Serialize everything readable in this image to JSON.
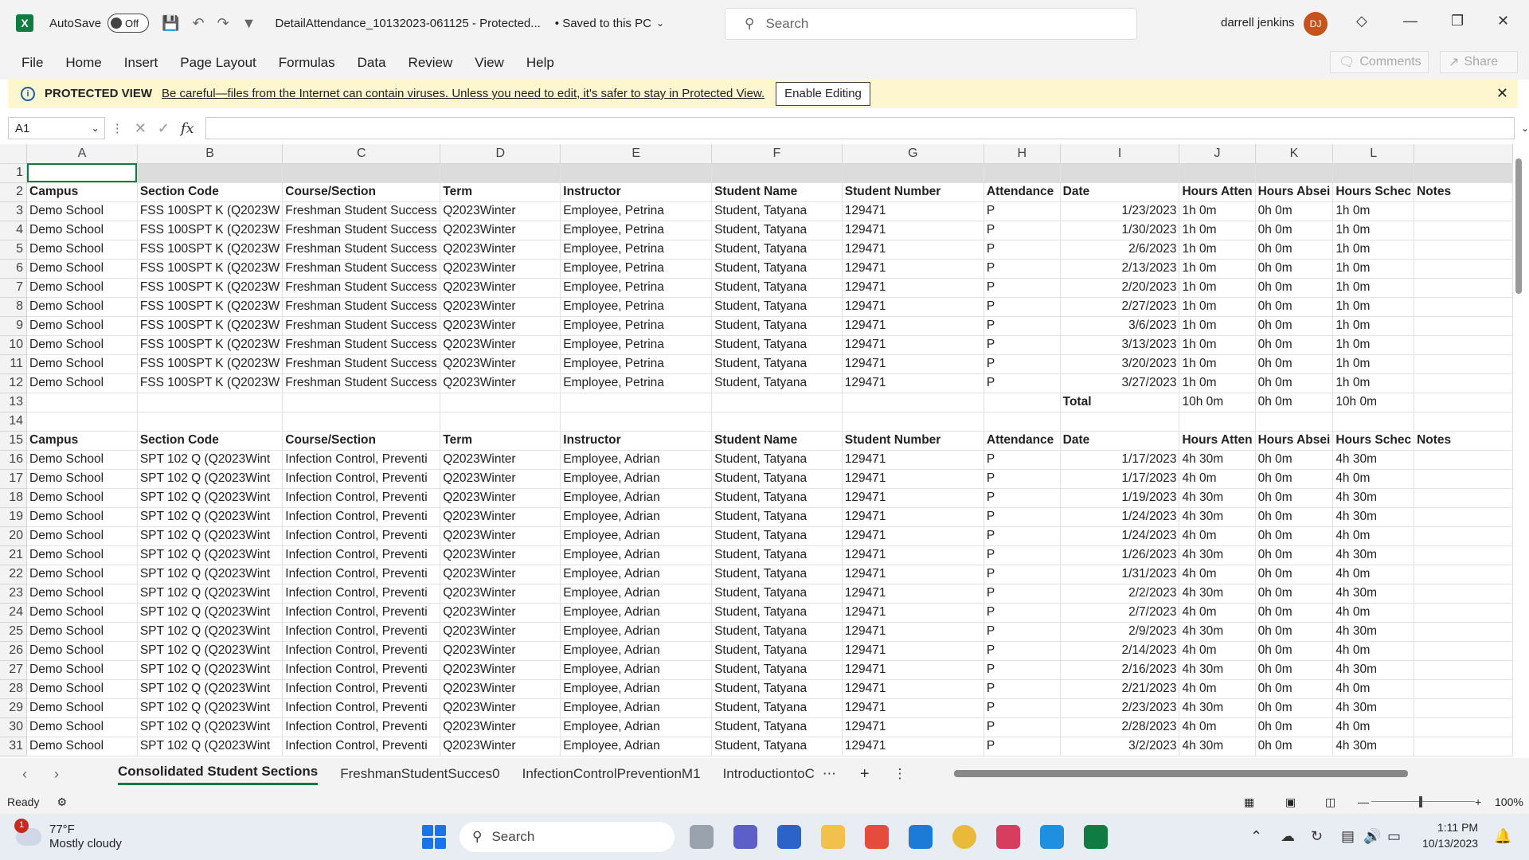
{
  "titlebar": {
    "autosave_label": "AutoSave",
    "autosave_state": "Off",
    "doc_title": "DetailAttendance_10132023-061125  -  Protected...",
    "saved_status": "• Saved to this PC",
    "search_placeholder": "Search",
    "user_name": "darrell jenkins",
    "user_initials": "DJ"
  },
  "menu": {
    "items": [
      "File",
      "Home",
      "Insert",
      "Page Layout",
      "Formulas",
      "Data",
      "Review",
      "View",
      "Help"
    ],
    "comments_label": "Comments",
    "share_label": "Share"
  },
  "protected_view": {
    "title": "PROTECTED VIEW",
    "message": "Be careful—files from the Internet can contain viruses. Unless you need to edit, it's safer to stay in Protected View.",
    "enable_label": "Enable Editing"
  },
  "formula_bar": {
    "name_box": "A1",
    "formula": ""
  },
  "columns": [
    "A",
    "B",
    "C",
    "D",
    "E",
    "F",
    "G",
    "H",
    "I",
    "J",
    "K",
    "L",
    ""
  ],
  "rows": [
    {
      "n": "1",
      "type": "r1",
      "cells": [
        "",
        "",
        "",
        "",
        "",
        "",
        "",
        "",
        "",
        "",
        "",
        "",
        ""
      ]
    },
    {
      "n": "2",
      "type": "hdr",
      "cells": [
        "Campus",
        "Section Code",
        "Course/Section",
        "Term",
        "Instructor",
        "Student Name",
        "Student Number",
        "Attendance",
        "Date",
        "Hours Atten",
        "Hours Absei",
        "Hours Scheс",
        "Notes"
      ]
    },
    {
      "n": "3",
      "type": "data",
      "cells": [
        "Demo School",
        "FSS 100SPT K (Q2023W",
        "Freshman Student Success",
        "Q2023Winter",
        "Employee, Petrina",
        "Student, Tatyana",
        "129471",
        "P",
        "1/23/2023",
        "1h 0m",
        "0h 0m",
        "1h 0m",
        ""
      ]
    },
    {
      "n": "4",
      "type": "data",
      "cells": [
        "Demo School",
        "FSS 100SPT K (Q2023W",
        "Freshman Student Success",
        "Q2023Winter",
        "Employee, Petrina",
        "Student, Tatyana",
        "129471",
        "P",
        "1/30/2023",
        "1h 0m",
        "0h 0m",
        "1h 0m",
        ""
      ]
    },
    {
      "n": "5",
      "type": "data",
      "cells": [
        "Demo School",
        "FSS 100SPT K (Q2023W",
        "Freshman Student Success",
        "Q2023Winter",
        "Employee, Petrina",
        "Student, Tatyana",
        "129471",
        "P",
        "2/6/2023",
        "1h 0m",
        "0h 0m",
        "1h 0m",
        ""
      ]
    },
    {
      "n": "6",
      "type": "data",
      "cells": [
        "Demo School",
        "FSS 100SPT K (Q2023W",
        "Freshman Student Success",
        "Q2023Winter",
        "Employee, Petrina",
        "Student, Tatyana",
        "129471",
        "P",
        "2/13/2023",
        "1h 0m",
        "0h 0m",
        "1h 0m",
        ""
      ]
    },
    {
      "n": "7",
      "type": "data",
      "cells": [
        "Demo School",
        "FSS 100SPT K (Q2023W",
        "Freshman Student Success",
        "Q2023Winter",
        "Employee, Petrina",
        "Student, Tatyana",
        "129471",
        "P",
        "2/20/2023",
        "1h 0m",
        "0h 0m",
        "1h 0m",
        ""
      ]
    },
    {
      "n": "8",
      "type": "data",
      "cells": [
        "Demo School",
        "FSS 100SPT K (Q2023W",
        "Freshman Student Success",
        "Q2023Winter",
        "Employee, Petrina",
        "Student, Tatyana",
        "129471",
        "P",
        "2/27/2023",
        "1h 0m",
        "0h 0m",
        "1h 0m",
        ""
      ]
    },
    {
      "n": "9",
      "type": "data",
      "cells": [
        "Demo School",
        "FSS 100SPT K (Q2023W",
        "Freshman Student Success",
        "Q2023Winter",
        "Employee, Petrina",
        "Student, Tatyana",
        "129471",
        "P",
        "3/6/2023",
        "1h 0m",
        "0h 0m",
        "1h 0m",
        ""
      ]
    },
    {
      "n": "10",
      "type": "data",
      "cells": [
        "Demo School",
        "FSS 100SPT K (Q2023W",
        "Freshman Student Success",
        "Q2023Winter",
        "Employee, Petrina",
        "Student, Tatyana",
        "129471",
        "P",
        "3/13/2023",
        "1h 0m",
        "0h 0m",
        "1h 0m",
        ""
      ]
    },
    {
      "n": "11",
      "type": "data",
      "cells": [
        "Demo School",
        "FSS 100SPT K (Q2023W",
        "Freshman Student Success",
        "Q2023Winter",
        "Employee, Petrina",
        "Student, Tatyana",
        "129471",
        "P",
        "3/20/2023",
        "1h 0m",
        "0h 0m",
        "1h 0m",
        ""
      ]
    },
    {
      "n": "12",
      "type": "data",
      "cells": [
        "Demo School",
        "FSS 100SPT K (Q2023W",
        "Freshman Student Success",
        "Q2023Winter",
        "Employee, Petrina",
        "Student, Tatyana",
        "129471",
        "P",
        "3/27/2023",
        "1h 0m",
        "0h 0m",
        "1h 0m",
        ""
      ]
    },
    {
      "n": "13",
      "type": "total",
      "cells": [
        "",
        "",
        "",
        "",
        "",
        "",
        "",
        "",
        "Total",
        "10h 0m",
        "0h 0m",
        "10h 0m",
        ""
      ]
    },
    {
      "n": "14",
      "type": "empty",
      "cells": [
        "",
        "",
        "",
        "",
        "",
        "",
        "",
        "",
        "",
        "",
        "",
        "",
        ""
      ]
    },
    {
      "n": "15",
      "type": "hdr",
      "cells": [
        "Campus",
        "Section Code",
        "Course/Section",
        "Term",
        "Instructor",
        "Student Name",
        "Student Number",
        "Attendance",
        "Date",
        "Hours Atten",
        "Hours Absei",
        "Hours Scheс",
        "Notes"
      ]
    },
    {
      "n": "16",
      "type": "data",
      "cells": [
        "Demo School",
        "SPT 102 Q (Q2023Wint",
        "Infection Control, Preventi",
        "Q2023Winter",
        "Employee, Adrian",
        "Student, Tatyana",
        "129471",
        "P",
        "1/17/2023",
        "4h 30m",
        "0h 0m",
        "4h 30m",
        ""
      ]
    },
    {
      "n": "17",
      "type": "data",
      "cells": [
        "Demo School",
        "SPT 102 Q (Q2023Wint",
        "Infection Control, Preventi",
        "Q2023Winter",
        "Employee, Adrian",
        "Student, Tatyana",
        "129471",
        "P",
        "1/17/2023",
        "4h 0m",
        "0h 0m",
        "4h 0m",
        ""
      ]
    },
    {
      "n": "18",
      "type": "data",
      "cells": [
        "Demo School",
        "SPT 102 Q (Q2023Wint",
        "Infection Control, Preventi",
        "Q2023Winter",
        "Employee, Adrian",
        "Student, Tatyana",
        "129471",
        "P",
        "1/19/2023",
        "4h 30m",
        "0h 0m",
        "4h 30m",
        ""
      ]
    },
    {
      "n": "19",
      "type": "data",
      "cells": [
        "Demo School",
        "SPT 102 Q (Q2023Wint",
        "Infection Control, Preventi",
        "Q2023Winter",
        "Employee, Adrian",
        "Student, Tatyana",
        "129471",
        "P",
        "1/24/2023",
        "4h 30m",
        "0h 0m",
        "4h 30m",
        ""
      ]
    },
    {
      "n": "20",
      "type": "data",
      "cells": [
        "Demo School",
        "SPT 102 Q (Q2023Wint",
        "Infection Control, Preventi",
        "Q2023Winter",
        "Employee, Adrian",
        "Student, Tatyana",
        "129471",
        "P",
        "1/24/2023",
        "4h 0m",
        "0h 0m",
        "4h 0m",
        ""
      ]
    },
    {
      "n": "21",
      "type": "data",
      "cells": [
        "Demo School",
        "SPT 102 Q (Q2023Wint",
        "Infection Control, Preventi",
        "Q2023Winter",
        "Employee, Adrian",
        "Student, Tatyana",
        "129471",
        "P",
        "1/26/2023",
        "4h 30m",
        "0h 0m",
        "4h 30m",
        ""
      ]
    },
    {
      "n": "22",
      "type": "data",
      "cells": [
        "Demo School",
        "SPT 102 Q (Q2023Wint",
        "Infection Control, Preventi",
        "Q2023Winter",
        "Employee, Adrian",
        "Student, Tatyana",
        "129471",
        "P",
        "1/31/2023",
        "4h 0m",
        "0h 0m",
        "4h 0m",
        ""
      ]
    },
    {
      "n": "23",
      "type": "data",
      "cells": [
        "Demo School",
        "SPT 102 Q (Q2023Wint",
        "Infection Control, Preventi",
        "Q2023Winter",
        "Employee, Adrian",
        "Student, Tatyana",
        "129471",
        "P",
        "2/2/2023",
        "4h 30m",
        "0h 0m",
        "4h 30m",
        ""
      ]
    },
    {
      "n": "24",
      "type": "data",
      "cells": [
        "Demo School",
        "SPT 102 Q (Q2023Wint",
        "Infection Control, Preventi",
        "Q2023Winter",
        "Employee, Adrian",
        "Student, Tatyana",
        "129471",
        "P",
        "2/7/2023",
        "4h 0m",
        "0h 0m",
        "4h 0m",
        ""
      ]
    },
    {
      "n": "25",
      "type": "data",
      "cells": [
        "Demo School",
        "SPT 102 Q (Q2023Wint",
        "Infection Control, Preventi",
        "Q2023Winter",
        "Employee, Adrian",
        "Student, Tatyana",
        "129471",
        "P",
        "2/9/2023",
        "4h 30m",
        "0h 0m",
        "4h 30m",
        ""
      ]
    },
    {
      "n": "26",
      "type": "data",
      "cells": [
        "Demo School",
        "SPT 102 Q (Q2023Wint",
        "Infection Control, Preventi",
        "Q2023Winter",
        "Employee, Adrian",
        "Student, Tatyana",
        "129471",
        "P",
        "2/14/2023",
        "4h 0m",
        "0h 0m",
        "4h 0m",
        ""
      ]
    },
    {
      "n": "27",
      "type": "data",
      "cells": [
        "Demo School",
        "SPT 102 Q (Q2023Wint",
        "Infection Control, Preventi",
        "Q2023Winter",
        "Employee, Adrian",
        "Student, Tatyana",
        "129471",
        "P",
        "2/16/2023",
        "4h 30m",
        "0h 0m",
        "4h 30m",
        ""
      ]
    },
    {
      "n": "28",
      "type": "data",
      "cells": [
        "Demo School",
        "SPT 102 Q (Q2023Wint",
        "Infection Control, Preventi",
        "Q2023Winter",
        "Employee, Adrian",
        "Student, Tatyana",
        "129471",
        "P",
        "2/21/2023",
        "4h 0m",
        "0h 0m",
        "4h 0m",
        ""
      ]
    },
    {
      "n": "29",
      "type": "data",
      "cells": [
        "Demo School",
        "SPT 102 Q (Q2023Wint",
        "Infection Control, Preventi",
        "Q2023Winter",
        "Employee, Adrian",
        "Student, Tatyana",
        "129471",
        "P",
        "2/23/2023",
        "4h 30m",
        "0h 0m",
        "4h 30m",
        ""
      ]
    },
    {
      "n": "30",
      "type": "data",
      "cells": [
        "Demo School",
        "SPT 102 Q (Q2023Wint",
        "Infection Control, Preventi",
        "Q2023Winter",
        "Employee, Adrian",
        "Student, Tatyana",
        "129471",
        "P",
        "2/28/2023",
        "4h 0m",
        "0h 0m",
        "4h 0m",
        ""
      ]
    },
    {
      "n": "31",
      "type": "data",
      "cells": [
        "Demo School",
        "SPT 102 Q (Q2023Wint",
        "Infection Control, Preventi",
        "Q2023Winter",
        "Employee, Adrian",
        "Student, Tatyana",
        "129471",
        "P",
        "3/2/2023",
        "4h 30m",
        "0h 0m",
        "4h 30m",
        ""
      ]
    }
  ],
  "sheet_tabs": [
    "Consolidated Student Sections",
    "FreshmanStudentSucces0",
    "InfectionControlPreventionM1",
    "IntroductiontoC"
  ],
  "status": {
    "ready": "Ready",
    "zoom": "100%"
  },
  "taskbar": {
    "temperature": "77°F",
    "weather": "Mostly cloudy",
    "weather_badge": "1",
    "search_label": "Search",
    "time": "1:11 PM",
    "date": "10/13/2023"
  }
}
